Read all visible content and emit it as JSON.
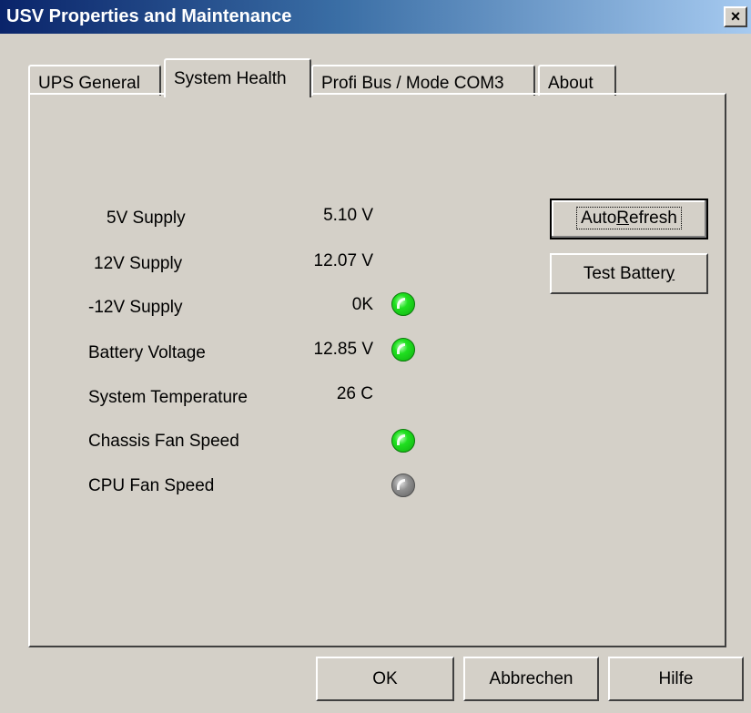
{
  "window": {
    "title": "USV Properties and Maintenance",
    "close_label": "×"
  },
  "tabs": [
    {
      "label": "UPS General"
    },
    {
      "label": "System Health"
    },
    {
      "label": "Profi Bus / Mode COM3"
    },
    {
      "label": "About"
    }
  ],
  "health": [
    {
      "label": "5V Supply",
      "value": "5.10 V",
      "indicator": "none"
    },
    {
      "label": "12V Supply",
      "value": "12.07 V",
      "indicator": "none"
    },
    {
      "label": "-12V Supply",
      "value": "0K",
      "indicator": "green"
    },
    {
      "label": "Battery Voltage",
      "value": "12.85 V",
      "indicator": "green"
    },
    {
      "label": "System Temperature",
      "value": "26 C",
      "indicator": "none"
    },
    {
      "label": "Chassis Fan Speed",
      "value": "",
      "indicator": "green"
    },
    {
      "label": "CPU Fan Speed",
      "value": "",
      "indicator": "gray"
    }
  ],
  "actions": {
    "autorefresh_pre": "Auto",
    "autorefresh_u": "R",
    "autorefresh_post": "efresh",
    "testbattery_pre": "Test Batter",
    "testbattery_u": "y"
  },
  "footer": {
    "ok": "OK",
    "cancel": "Abbrechen",
    "help": "Hilfe"
  },
  "colors": {
    "led_on": "#20e020",
    "led_off": "#909090",
    "titlebar": "#0a246a"
  }
}
